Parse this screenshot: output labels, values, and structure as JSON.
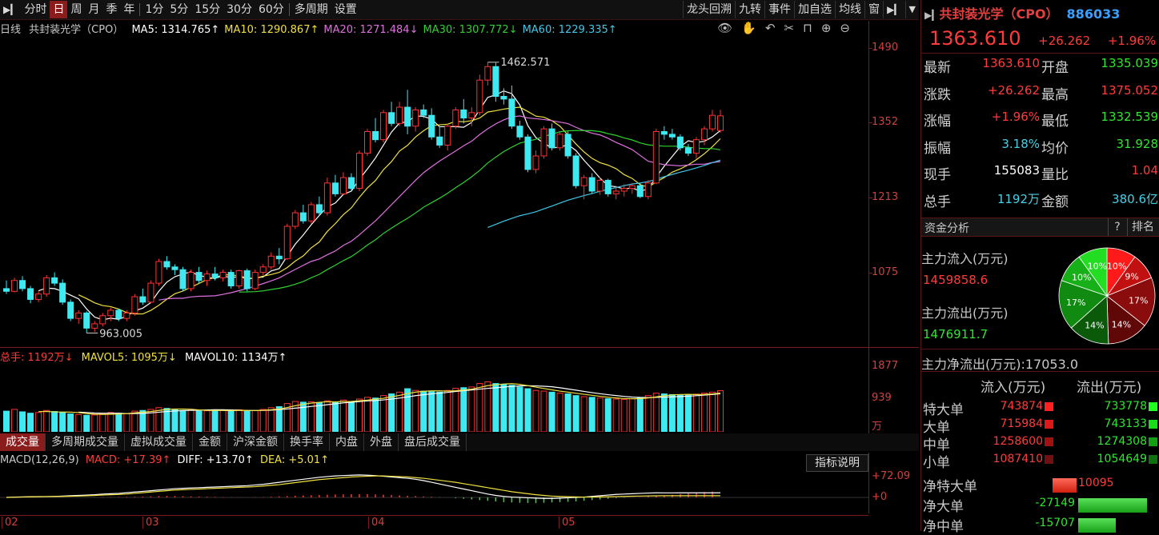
{
  "toolbar": {
    "left_items": [
      "分时",
      "日",
      "周",
      "月",
      "季",
      "年",
      "1分",
      "5分",
      "15分",
      "30分",
      "60分",
      "多周期",
      "设置"
    ],
    "active": "日",
    "right_items": [
      "龙头回溯",
      "九转",
      "事件",
      "加自选",
      "均线",
      "窗"
    ]
  },
  "main": {
    "period_label": "日线",
    "stock_label": "共封装光学（CPO）",
    "ma": [
      {
        "label": "MA5: 1314.765↑",
        "color": "#ffffff"
      },
      {
        "label": "MA10: 1290.867↑",
        "color": "#f0e040"
      },
      {
        "label": "MA20: 1271.484↓",
        "color": "#e070e0"
      },
      {
        "label": "MA30: 1307.772↓",
        "color": "#30d030"
      },
      {
        "label": "MA60: 1229.335↑",
        "color": "#40c8e8"
      }
    ],
    "price_axis": [
      "1490",
      "1352",
      "1213",
      "1075"
    ],
    "high_label": "1462.571",
    "low_label": "963.005",
    "date_labels": [
      "02",
      "03",
      "04",
      "05"
    ]
  },
  "volume": {
    "total_label": "总手: 1192万↓",
    "mavol5_label": "MAVOL5: 1095万↓",
    "mavol10_label": "MAVOL10: 1134万↑",
    "axis": [
      "1877",
      "939",
      "万"
    ]
  },
  "bottom_tabs": [
    "成交量",
    "多周期成交量",
    "虚拟成交量",
    "金额",
    "沪深金额",
    "换手率",
    "内盘",
    "外盘",
    "盘后成交量"
  ],
  "bottom_tab_active": "成交量",
  "macd": {
    "params": "MACD(12,26,9)",
    "macd_label": "MACD: +17.39↑",
    "diff_label": "DIFF: +13.70↑",
    "dea_label": "DEA: +5.01↑",
    "axis": [
      "+72.09",
      "+0"
    ],
    "button": "指标说明"
  },
  "panel": {
    "title": "共封装光学（CPO）",
    "code": "886033",
    "price": "1363.610",
    "change": "+26.262",
    "change_pct": "+1.96%",
    "quotes": [
      {
        "l1": "最新",
        "v1": "1363.610",
        "c1": "red",
        "l2": "开盘",
        "v2": "1335.039",
        "c2": "green"
      },
      {
        "l1": "涨跌",
        "v1": "+26.262",
        "c1": "red",
        "l2": "最高",
        "v2": "1375.052",
        "c2": "red"
      },
      {
        "l1": "涨幅",
        "v1": "+1.96%",
        "c1": "red",
        "l2": "最低",
        "v2": "1332.539",
        "c2": "green"
      },
      {
        "l1": "振幅",
        "v1": "3.18%",
        "c1": "cyan",
        "l2": "均价",
        "v2": "31.928",
        "c2": "green"
      },
      {
        "l1": "现手",
        "v1": "155083",
        "c1": "white",
        "l2": "量比",
        "v2": "1.04",
        "c2": "red"
      },
      {
        "l1": "总手",
        "v1": "1192万",
        "c1": "cyan",
        "l2": "金额",
        "v2": "380.6亿",
        "c2": "cyan"
      }
    ],
    "fund_header": "资金分析",
    "fund_q": "?",
    "fund_rank": "排名",
    "inflow_label": "主力流入(万元)",
    "inflow_value": "1459858.6",
    "outflow_label": "主力流出(万元)",
    "outflow_value": "1476911.7",
    "net_label": "主力净流出(万元):17053.0",
    "pie": [
      {
        "pct": "10%",
        "color": "#ff1a1a",
        "value": 10
      },
      {
        "pct": "9%",
        "color": "#c01010",
        "value": 9
      },
      {
        "pct": "17%",
        "color": "#8a0c0c",
        "value": 17
      },
      {
        "pct": "14%",
        "color": "#600808",
        "value": 14
      },
      {
        "pct": "14%",
        "color": "#0a5a0a",
        "value": 14
      },
      {
        "pct": "17%",
        "color": "#108a10",
        "value": 17
      },
      {
        "pct": "10%",
        "color": "#18b018",
        "value": 10
      },
      {
        "pct": "10%",
        "color": "#22dd22",
        "value": 10
      }
    ],
    "flow_header": [
      "流入(万元)",
      "流出(万元)"
    ],
    "flow_rows": [
      {
        "label": "特大单",
        "in": "743874",
        "out": "733778"
      },
      {
        "label": "大单",
        "in": "715984",
        "out": "743133"
      },
      {
        "label": "中单",
        "in": "1258600",
        "out": "1274308"
      },
      {
        "label": "小单",
        "in": "1087410",
        "out": "1054649"
      }
    ],
    "net_rows": [
      {
        "label": "净特大单",
        "value": "10095",
        "dir": "pos",
        "ratio": 0.35
      },
      {
        "label": "净大单",
        "value": "-27149",
        "dir": "neg",
        "ratio": 1.0
      },
      {
        "label": "净中单",
        "value": "-15707",
        "dir": "neg",
        "ratio": 0.55
      }
    ]
  },
  "chart_data": {
    "type": "candlestick",
    "y_range": [
      940,
      1510
    ],
    "candles": [
      [
        1045,
        1060,
        1035,
        1040
      ],
      [
        1040,
        1065,
        1038,
        1060
      ],
      [
        1060,
        1068,
        1040,
        1045
      ],
      [
        1045,
        1050,
        1018,
        1025
      ],
      [
        1025,
        1040,
        1020,
        1035
      ],
      [
        1035,
        1070,
        1030,
        1065
      ],
      [
        1065,
        1075,
        1050,
        1055
      ],
      [
        1055,
        1062,
        1015,
        1020
      ],
      [
        1020,
        1025,
        985,
        990
      ],
      [
        990,
        1005,
        980,
        1000
      ],
      [
        1000,
        1003,
        963,
        972
      ],
      [
        972,
        985,
        965,
        980
      ],
      [
        980,
        1000,
        975,
        995
      ],
      [
        995,
        1010,
        985,
        1005
      ],
      [
        1005,
        1008,
        985,
        990
      ],
      [
        990,
        1005,
        985,
        1000
      ],
      [
        1000,
        1035,
        995,
        1030
      ],
      [
        1030,
        1045,
        1015,
        1020
      ],
      [
        1020,
        1060,
        1018,
        1055
      ],
      [
        1055,
        1100,
        1050,
        1095
      ],
      [
        1095,
        1105,
        1080,
        1085
      ],
      [
        1085,
        1090,
        1070,
        1080
      ],
      [
        1080,
        1085,
        1040,
        1045
      ],
      [
        1045,
        1080,
        1040,
        1075
      ],
      [
        1075,
        1085,
        1055,
        1060
      ],
      [
        1060,
        1078,
        1050,
        1072
      ],
      [
        1072,
        1085,
        1060,
        1065
      ],
      [
        1065,
        1080,
        1058,
        1075
      ],
      [
        1075,
        1080,
        1045,
        1050
      ],
      [
        1050,
        1080,
        1045,
        1078
      ],
      [
        1078,
        1082,
        1040,
        1045
      ],
      [
        1045,
        1080,
        1042,
        1075
      ],
      [
        1075,
        1090,
        1070,
        1085
      ],
      [
        1085,
        1112,
        1080,
        1105
      ],
      [
        1105,
        1120,
        1090,
        1100
      ],
      [
        1100,
        1165,
        1098,
        1160
      ],
      [
        1160,
        1190,
        1155,
        1185
      ],
      [
        1185,
        1200,
        1165,
        1170
      ],
      [
        1170,
        1205,
        1165,
        1200
      ],
      [
        1200,
        1215,
        1180,
        1185
      ],
      [
        1185,
        1250,
        1180,
        1240
      ],
      [
        1240,
        1255,
        1215,
        1220
      ],
      [
        1220,
        1260,
        1218,
        1250
      ],
      [
        1250,
        1258,
        1225,
        1230
      ],
      [
        1230,
        1300,
        1225,
        1295
      ],
      [
        1295,
        1340,
        1290,
        1335
      ],
      [
        1335,
        1360,
        1315,
        1320
      ],
      [
        1320,
        1375,
        1315,
        1370
      ],
      [
        1370,
        1390,
        1345,
        1350
      ],
      [
        1350,
        1390,
        1345,
        1380
      ],
      [
        1380,
        1412,
        1330,
        1345
      ],
      [
        1345,
        1380,
        1335,
        1375
      ],
      [
        1375,
        1385,
        1360,
        1365
      ],
      [
        1365,
        1378,
        1320,
        1325
      ],
      [
        1325,
        1345,
        1305,
        1310
      ],
      [
        1310,
        1350,
        1300,
        1345
      ],
      [
        1345,
        1380,
        1340,
        1375
      ],
      [
        1375,
        1395,
        1350,
        1360
      ],
      [
        1360,
        1380,
        1345,
        1370
      ],
      [
        1370,
        1440,
        1365,
        1430
      ],
      [
        1430,
        1463,
        1420,
        1455
      ],
      [
        1455,
        1462,
        1390,
        1400
      ],
      [
        1400,
        1415,
        1385,
        1395
      ],
      [
        1395,
        1420,
        1340,
        1345
      ],
      [
        1345,
        1355,
        1320,
        1325
      ],
      [
        1325,
        1330,
        1260,
        1265
      ],
      [
        1265,
        1300,
        1258,
        1290
      ],
      [
        1290,
        1345,
        1285,
        1340
      ],
      [
        1340,
        1350,
        1300,
        1305
      ],
      [
        1305,
        1335,
        1300,
        1330
      ],
      [
        1330,
        1335,
        1285,
        1290
      ],
      [
        1290,
        1295,
        1230,
        1235
      ],
      [
        1235,
        1255,
        1210,
        1250
      ],
      [
        1250,
        1258,
        1220,
        1225
      ],
      [
        1225,
        1250,
        1218,
        1245
      ],
      [
        1245,
        1248,
        1215,
        1220
      ],
      [
        1220,
        1235,
        1210,
        1225
      ],
      [
        1225,
        1238,
        1215,
        1230
      ],
      [
        1230,
        1240,
        1220,
        1235
      ],
      [
        1235,
        1240,
        1212,
        1215
      ],
      [
        1215,
        1245,
        1210,
        1240
      ],
      [
        1240,
        1340,
        1238,
        1335
      ],
      [
        1335,
        1345,
        1320,
        1330
      ],
      [
        1330,
        1340,
        1320,
        1325
      ],
      [
        1325,
        1330,
        1300,
        1305
      ],
      [
        1305,
        1312,
        1290,
        1295
      ],
      [
        1295,
        1325,
        1285,
        1320
      ],
      [
        1320,
        1345,
        1310,
        1340
      ],
      [
        1340,
        1375,
        1335,
        1365
      ],
      [
        1337,
        1375,
        1333,
        1364
      ]
    ],
    "volume": [
      600,
      650,
      580,
      540,
      560,
      620,
      590,
      560,
      520,
      500,
      480,
      490,
      520,
      560,
      540,
      530,
      600,
      620,
      650,
      700,
      680,
      650,
      620,
      630,
      600,
      610,
      640,
      620,
      600,
      640,
      600,
      620,
      650,
      700,
      730,
      820,
      880,
      860,
      870,
      850,
      900,
      850,
      920,
      880,
      950,
      1000,
      980,
      1050,
      1100,
      1150,
      1250,
      1200,
      1180,
      1160,
      1150,
      1200,
      1260,
      1280,
      1300,
      1400,
      1450,
      1400,
      1380,
      1350,
      1300,
      1250,
      1200,
      1180,
      1150,
      1120,
      1100,
      1050,
      1020,
      1000,
      980,
      960,
      950,
      940,
      960,
      1000,
      1050,
      1120,
      1100,
      1080,
      1060,
      1070,
      1090,
      1120,
      1150,
      1192
    ],
    "macd_hist": [
      0.5,
      0.3,
      0.2,
      0,
      -0.2,
      0.3,
      0.5,
      0.4,
      0.2,
      0.1,
      0.3,
      0.6,
      0.8,
      1,
      1.2,
      1.5,
      2,
      2.5,
      3,
      4,
      4.5,
      4,
      3.5,
      3,
      2.5,
      2,
      1.5,
      1,
      0.8,
      0.6,
      0.5,
      0.8,
      1.2,
      2,
      3,
      4,
      5,
      6,
      6.5,
      7,
      8,
      8.5,
      9,
      9.5,
      10,
      10,
      9,
      8,
      7,
      6,
      5,
      4,
      3,
      2,
      1,
      0,
      -2,
      -4,
      -6,
      -8,
      -10,
      -12,
      -14,
      -15,
      -16,
      -16.5,
      -17,
      -16,
      -15,
      -14,
      -13,
      -12,
      -10,
      -8,
      -6,
      -4,
      -2,
      -1,
      0,
      1,
      3,
      5,
      6,
      8,
      10,
      12,
      14,
      16,
      17.39
    ],
    "diff": [
      0,
      1,
      1.5,
      2,
      2.3,
      2.5,
      3,
      4,
      5,
      6,
      7,
      8,
      10,
      11,
      12,
      14,
      16,
      18,
      20,
      22,
      24,
      26,
      27,
      28,
      29,
      30,
      31,
      32,
      33,
      34,
      35,
      37,
      39,
      42,
      45,
      48,
      51,
      54,
      57,
      60,
      62,
      64,
      65,
      66,
      67,
      66,
      65,
      63,
      61,
      59,
      57,
      54,
      50,
      45,
      40,
      35,
      30,
      25,
      20,
      15,
      10,
      6,
      3,
      1,
      0,
      -1,
      -2,
      -3,
      -3,
      -2,
      -1,
      0,
      1,
      3,
      5,
      7,
      9,
      10,
      11,
      12,
      13,
      13.7,
      13.5,
      13.6,
      13.7,
      13.7,
      13.7,
      13.7,
      13.7,
      13.7
    ],
    "dea": [
      0,
      0.5,
      1,
      1.5,
      2,
      2.3,
      2.6,
      3,
      3.5,
      4,
      5,
      6,
      7,
      8,
      9,
      10,
      12,
      14,
      16,
      18,
      20,
      22,
      23,
      24,
      25,
      26,
      27,
      28,
      29,
      30,
      31,
      32,
      34,
      36,
      38,
      41,
      44,
      47,
      50,
      53,
      55,
      57,
      59,
      61,
      62,
      63,
      64,
      64,
      63,
      62,
      61,
      59,
      57,
      54,
      51,
      48,
      45,
      41,
      37,
      33,
      29,
      25,
      21,
      17,
      14,
      11,
      8,
      6,
      4,
      3,
      2,
      1.5,
      1,
      1,
      1.5,
      2,
      2.5,
      3,
      3.5,
      4,
      4.5,
      4.8,
      5,
      5,
      5,
      5,
      5.01,
      5.01,
      5.01,
      5.01
    ]
  }
}
